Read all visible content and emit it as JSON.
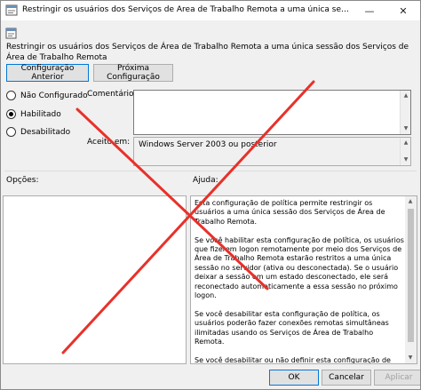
{
  "window": {
    "title": "Restringir os usuários dos Serviços de Área de Trabalho Remota a uma única sessão dos Serviços...",
    "minimize_glyph": "—",
    "close_glyph": "✕",
    "icon": "policy-icon"
  },
  "policy": {
    "heading": "Restringir os usuários dos Serviços de Área de Trabalho Remota a uma única sessão dos Serviços de Área de Trabalho Remota",
    "prev_label": "Configuração Anterior",
    "next_label": "Próxima Configuração"
  },
  "state": {
    "options": [
      {
        "label": "Não Configurado",
        "selected": false
      },
      {
        "label": "Habilitado",
        "selected": true
      },
      {
        "label": "Desabilitado",
        "selected": false
      }
    ]
  },
  "comment": {
    "label": "Comentário:",
    "value": ""
  },
  "supported": {
    "label": "Aceito em:",
    "value": "Windows Server 2003 ou posterior"
  },
  "options_panel": {
    "label": "Opções:"
  },
  "help_panel": {
    "label": "Ajuda:",
    "paragraphs": [
      "Esta configuração de política permite restringir os usuários a uma única sessão dos Serviços de Área de Trabalho Remota.",
      "Se você habilitar esta configuração de política, os usuários que fizerem logon remotamente por meio dos Serviços de Área de Trabalho Remota estarão restritos a uma única sessão no servidor (ativa ou desconectada). Se o usuário deixar a sessão em um estado desconectado, ele será reconectado automaticamente a essa sessão no próximo logon.",
      "Se você desabilitar esta configuração de política, os usuários poderão fazer conexões remotas simultâneas ilimitadas usando os Serviços de Área de Trabalho Remota.",
      "Se você desabilitar ou não definir esta configuração de política, a configuração de política não será especificada no nível da Política de Grupo."
    ]
  },
  "footer": {
    "ok_label": "OK",
    "cancel_label": "Cancelar",
    "apply_label": "Aplicar"
  },
  "colors": {
    "overlay_x": "#e8312a",
    "focus_border": "#0078d7"
  }
}
